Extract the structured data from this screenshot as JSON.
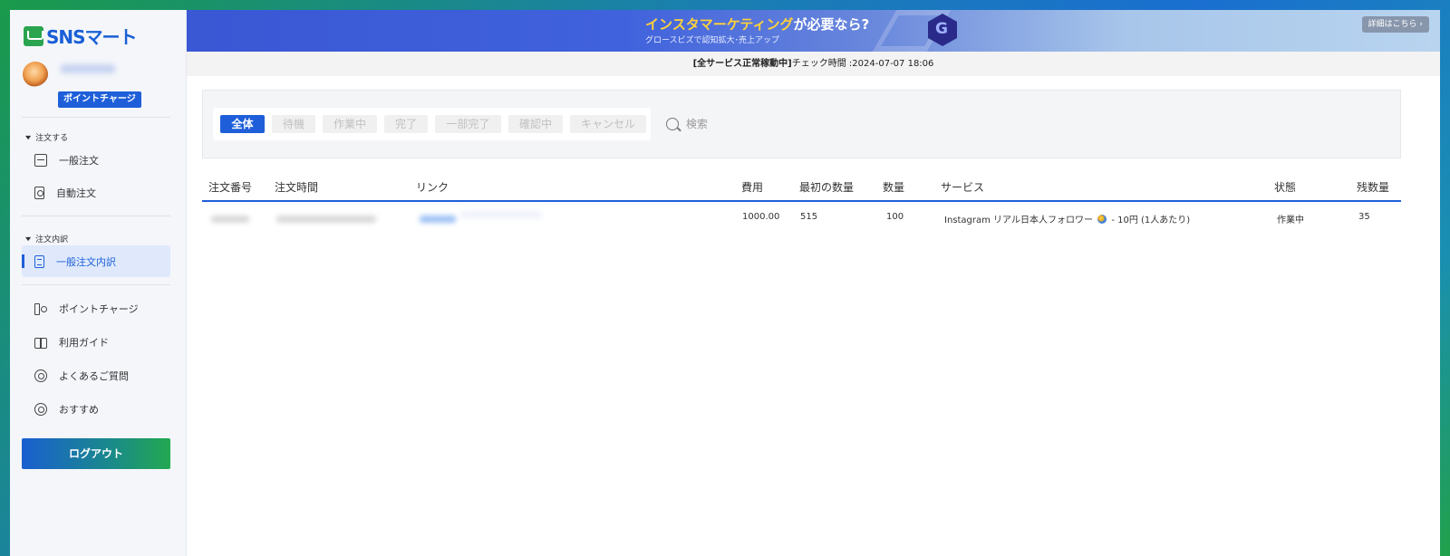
{
  "brand": {
    "logo_text": "SNSマート"
  },
  "user": {
    "charge_badge": "ポイントチャージ"
  },
  "sidebar": {
    "section_order": "注文する",
    "order_items": [
      {
        "label": "一般注文",
        "icon": "general-order-icon"
      },
      {
        "label": "自動注文",
        "icon": "auto-order-icon"
      }
    ],
    "section_history": "注文内訳",
    "history_items": [
      {
        "label": "一般注文内訳",
        "icon": "order-history-icon",
        "active": true
      }
    ],
    "misc_items": [
      {
        "label": "ポイントチャージ",
        "icon": "wallet-icon"
      },
      {
        "label": "利用ガイド",
        "icon": "book-icon"
      },
      {
        "label": "よくあるご質問",
        "icon": "faq-icon"
      },
      {
        "label": "おすすめ",
        "icon": "recommend-icon"
      }
    ],
    "logout_label": "ログアウト"
  },
  "banner": {
    "title_highlight": "インスタマーケティング",
    "title_rest": "が必要なら?",
    "subtitle": "グロースビズで認知拡大･売上アップ",
    "details_button": "詳細はこちら ›"
  },
  "status": {
    "label": "[全サービス正常稼動中]",
    "check_text": "チェック時間 :2024-07-07 18:06"
  },
  "filters": {
    "tabs": [
      "全体",
      "待機",
      "作業中",
      "完了",
      "一部完了",
      "確認中",
      "キャンセル"
    ],
    "active_tab": "全体",
    "search_label": "検索"
  },
  "table": {
    "columns": [
      "注文番号",
      "注文時間",
      "リンク",
      "費用",
      "最初の数量",
      "数量",
      "サービス",
      "状態",
      "残数量"
    ],
    "rows": [
      {
        "cost": "1000.00",
        "initial_qty": "515",
        "qty": "100",
        "service_prefix": "Instagram リアル日本人フォロワー",
        "service_suffix": "- 10円 (1人あたり)",
        "status": "作業中",
        "remaining": "35"
      }
    ]
  },
  "colors": {
    "accent": "#1e5fd9",
    "brand_green": "#2aa44f",
    "banner_highlight": "#ffd23a"
  }
}
